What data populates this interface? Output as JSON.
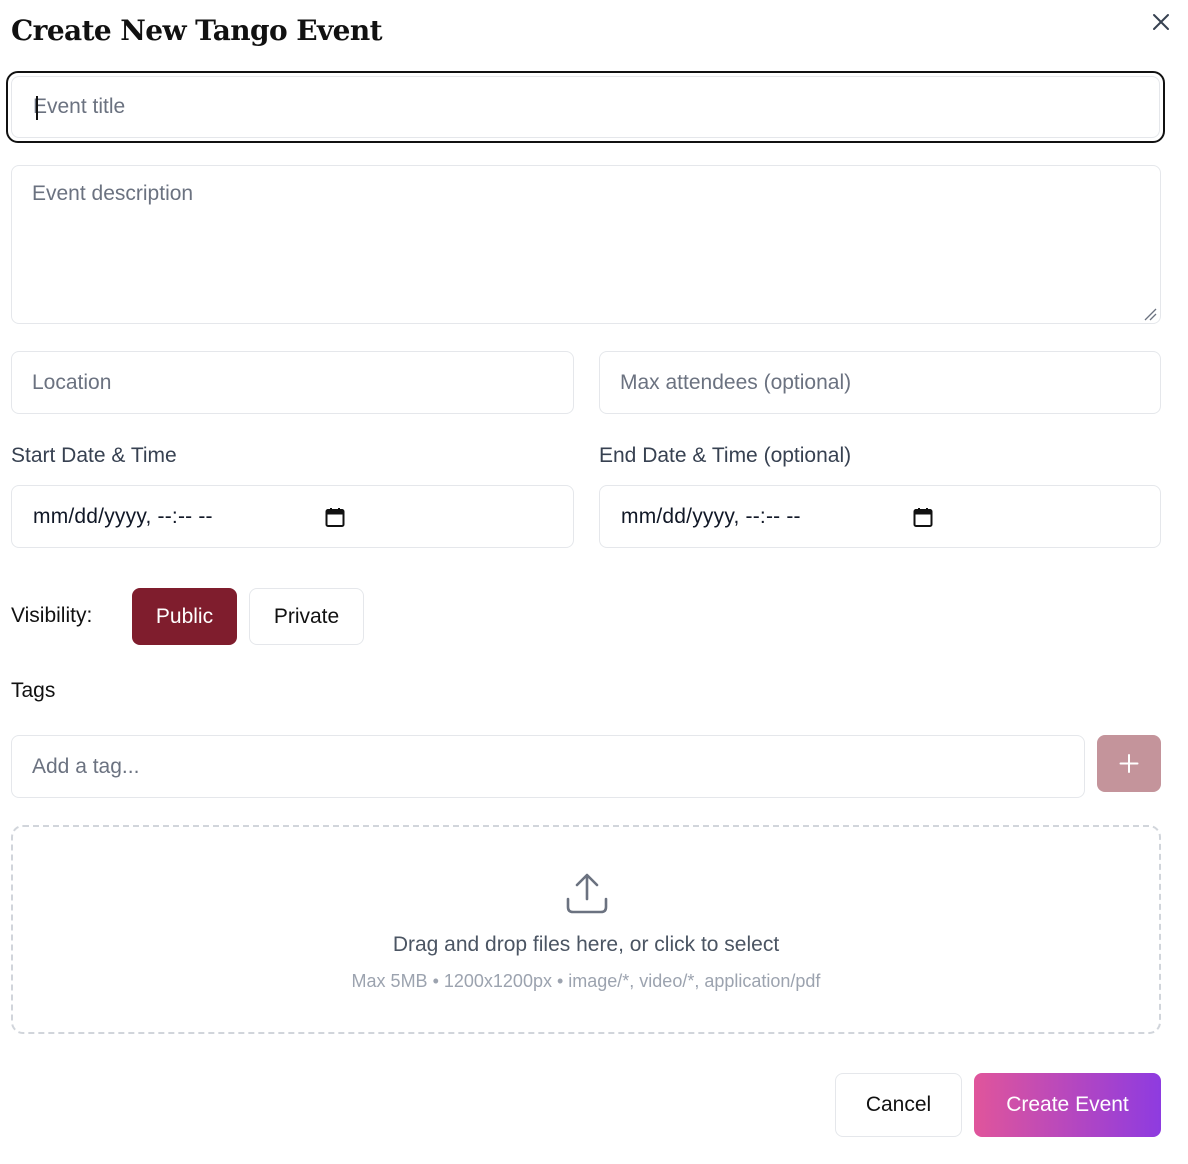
{
  "dialog": {
    "title": "Create New Tango Event",
    "close_icon": "close-icon"
  },
  "form": {
    "title_placeholder": "Event title",
    "title_value": "",
    "description_placeholder": "Event description",
    "description_value": "",
    "location_placeholder": "Location",
    "max_attendees_placeholder": "Max attendees (optional)",
    "start_label": "Start Date & Time",
    "start_value": "mm/dd/yyyy, --:-- --",
    "end_label": "End Date & Time (optional)",
    "end_value": "mm/dd/yyyy, --:-- --",
    "calendar_icon": "calendar-icon"
  },
  "visibility": {
    "label": "Visibility:",
    "options": [
      "Public",
      "Private"
    ],
    "selected": "Public",
    "selected_color": "#7f1d2d"
  },
  "tags": {
    "label": "Tags",
    "placeholder": "Add a tag...",
    "add_icon": "plus-icon",
    "add_button_color": "#c4949b"
  },
  "upload": {
    "icon": "upload-icon",
    "text": "Drag and drop files here, or click to select",
    "hint": "Max 5MB • 1200x1200px • image/*, video/*, application/pdf"
  },
  "actions": {
    "cancel_label": "Cancel",
    "create_label": "Create Event",
    "create_gradient": [
      "#e0559b",
      "#8e3be0"
    ]
  }
}
